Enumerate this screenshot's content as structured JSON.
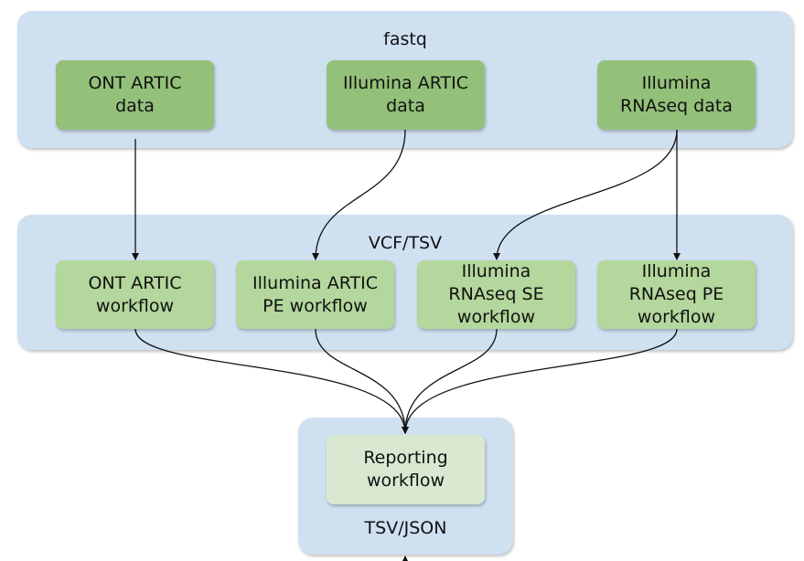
{
  "colors": {
    "container": "#cfe0f1",
    "data_box": "#94c17a",
    "workflow_box": "#b3d79c",
    "reporting_box": "#d9e9d1"
  },
  "fastq": {
    "title": "fastq",
    "items": [
      "ONT ARTIC\ndata",
      "Illumina ARTIC\ndata",
      "Illumina\nRNAseq data"
    ]
  },
  "vcf": {
    "title": "VCF/TSV",
    "items": [
      "ONT ARTIC\nworkflow",
      "Illumina ARTIC\nPE workflow",
      "Illumina\nRNAseq SE\nworkflow",
      "Illumina\nRNAseq PE\nworkflow"
    ]
  },
  "report": {
    "title": "TSV/JSON",
    "item": "Reporting\nworkflow"
  }
}
